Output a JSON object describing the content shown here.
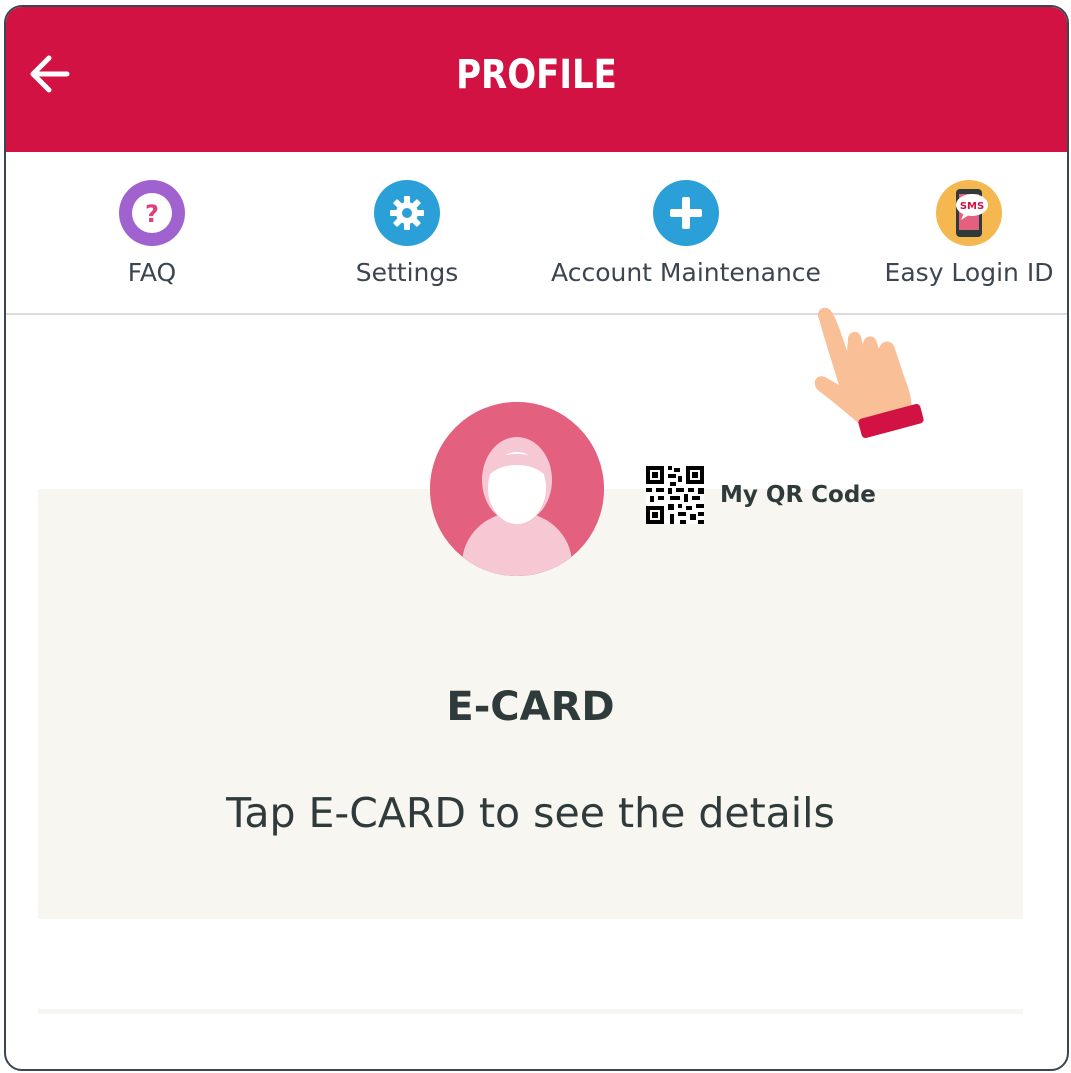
{
  "header": {
    "title": "PROFILE",
    "back_icon": "arrow-left-icon",
    "color": "#d21242"
  },
  "menu": {
    "items": [
      {
        "label": "FAQ",
        "icon": "question-icon",
        "color": "#9b59c9"
      },
      {
        "label": "Settings",
        "icon": "gear-icon",
        "color": "#2a9fd8"
      },
      {
        "label": "Account Maintenance",
        "icon": "plus-icon",
        "color": "#2a9fd8"
      },
      {
        "label": "Easy Login ID",
        "icon": "sms-phone-icon",
        "color": "#f4b750"
      }
    ]
  },
  "profile": {
    "avatar_icon": "user-avatar-icon",
    "qr_label": "My QR Code",
    "qr_icon": "qr-code-icon"
  },
  "ecard": {
    "title": "E-CARD",
    "subtitle": "Tap E-CARD to see the details"
  },
  "overlay": {
    "pointer_icon": "pointing-hand-icon"
  }
}
